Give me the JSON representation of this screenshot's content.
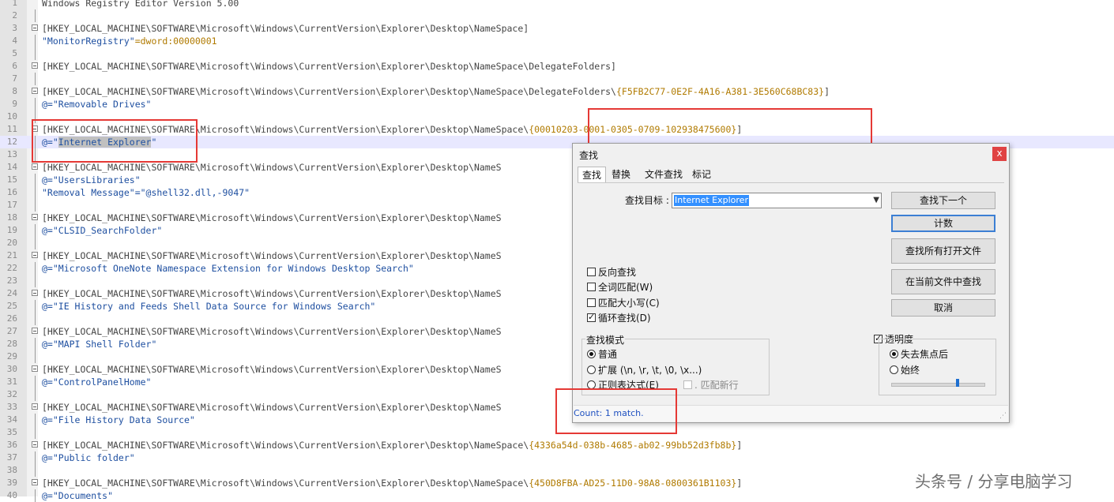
{
  "editor": {
    "lines": [
      {
        "n": "1",
        "fold": "",
        "parts": [
          {
            "t": "Windows Registry Editor Version 5.00",
            "c": "k"
          }
        ]
      },
      {
        "n": "2",
        "fold": "line",
        "parts": []
      },
      {
        "n": "3",
        "fold": "box",
        "parts": [
          {
            "t": "[HKEY_LOCAL_MACHINE\\SOFTWARE\\Microsoft\\Windows\\CurrentVersion\\Explorer\\Desktop\\NameSpace]",
            "c": "k"
          }
        ]
      },
      {
        "n": "4",
        "fold": "line",
        "parts": [
          {
            "t": "\"MonitorRegistry\"",
            "c": "str"
          },
          {
            "t": "=dword:00000001",
            "c": "g"
          }
        ]
      },
      {
        "n": "5",
        "fold": "line",
        "parts": []
      },
      {
        "n": "6",
        "fold": "box",
        "parts": [
          {
            "t": "[HKEY_LOCAL_MACHINE\\SOFTWARE\\Microsoft\\Windows\\CurrentVersion\\Explorer\\Desktop\\NameSpace\\DelegateFolders]",
            "c": "k"
          }
        ]
      },
      {
        "n": "7",
        "fold": "line",
        "parts": []
      },
      {
        "n": "8",
        "fold": "box",
        "parts": [
          {
            "t": "[HKEY_LOCAL_MACHINE\\SOFTWARE\\Microsoft\\Windows\\CurrentVersion\\Explorer\\Desktop\\NameSpace\\DelegateFolders\\",
            "c": "k"
          },
          {
            "t": "{F5FB2C77-0E2F-4A16-A381-3E560C68BC83}",
            "c": "g"
          },
          {
            "t": "]",
            "c": "k"
          }
        ]
      },
      {
        "n": "9",
        "fold": "line",
        "parts": [
          {
            "t": "@=\"Removable Drives\"",
            "c": "str"
          }
        ]
      },
      {
        "n": "10",
        "fold": "line",
        "parts": []
      },
      {
        "n": "11",
        "fold": "box",
        "parts": [
          {
            "t": "[HKEY_LOCAL_MACHINE\\SOFTWARE\\Microsoft\\Windows\\CurrentVersion\\Explorer\\Desktop\\NameSpace\\",
            "c": "k"
          },
          {
            "t": "{00010203-0001-0305-0709-102938475600}",
            "c": "g"
          },
          {
            "t": "]",
            "c": "k"
          }
        ]
      },
      {
        "n": "12",
        "fold": "line",
        "current": true,
        "parts": [
          {
            "t": "@=\"",
            "c": "str"
          },
          {
            "t": "Internet Explorer",
            "c": "str sel"
          },
          {
            "t": "\"",
            "c": "str"
          }
        ]
      },
      {
        "n": "13",
        "fold": "line",
        "parts": []
      },
      {
        "n": "14",
        "fold": "box",
        "parts": [
          {
            "t": "[HKEY_LOCAL_MACHINE\\SOFTWARE\\Microsoft\\Windows\\CurrentVersion\\Explorer\\Desktop\\NameS",
            "c": "k"
          }
        ]
      },
      {
        "n": "15",
        "fold": "line",
        "parts": [
          {
            "t": "@=\"UsersLibraries\"",
            "c": "str"
          }
        ]
      },
      {
        "n": "16",
        "fold": "line",
        "parts": [
          {
            "t": "\"Removal Message\"=\"@shell32.dll,-9047\"",
            "c": "str"
          }
        ]
      },
      {
        "n": "17",
        "fold": "line",
        "parts": []
      },
      {
        "n": "18",
        "fold": "box",
        "parts": [
          {
            "t": "[HKEY_LOCAL_MACHINE\\SOFTWARE\\Microsoft\\Windows\\CurrentVersion\\Explorer\\Desktop\\NameS",
            "c": "k"
          }
        ]
      },
      {
        "n": "19",
        "fold": "line",
        "parts": [
          {
            "t": "@=\"CLSID_SearchFolder\"",
            "c": "str"
          }
        ]
      },
      {
        "n": "20",
        "fold": "line",
        "parts": []
      },
      {
        "n": "21",
        "fold": "box",
        "parts": [
          {
            "t": "[HKEY_LOCAL_MACHINE\\SOFTWARE\\Microsoft\\Windows\\CurrentVersion\\Explorer\\Desktop\\NameS",
            "c": "k"
          }
        ]
      },
      {
        "n": "22",
        "fold": "line",
        "parts": [
          {
            "t": "@=\"Microsoft OneNote Namespace Extension for Windows Desktop Search\"",
            "c": "str"
          }
        ]
      },
      {
        "n": "23",
        "fold": "line",
        "parts": []
      },
      {
        "n": "24",
        "fold": "box",
        "parts": [
          {
            "t": "[HKEY_LOCAL_MACHINE\\SOFTWARE\\Microsoft\\Windows\\CurrentVersion\\Explorer\\Desktop\\NameS",
            "c": "k"
          }
        ]
      },
      {
        "n": "25",
        "fold": "line",
        "parts": [
          {
            "t": "@=\"IE History and Feeds Shell Data Source for Windows Search\"",
            "c": "str"
          }
        ]
      },
      {
        "n": "26",
        "fold": "line",
        "parts": []
      },
      {
        "n": "27",
        "fold": "box",
        "parts": [
          {
            "t": "[HKEY_LOCAL_MACHINE\\SOFTWARE\\Microsoft\\Windows\\CurrentVersion\\Explorer\\Desktop\\NameS",
            "c": "k"
          }
        ]
      },
      {
        "n": "28",
        "fold": "line",
        "parts": [
          {
            "t": "@=\"MAPI Shell Folder\"",
            "c": "str"
          }
        ]
      },
      {
        "n": "29",
        "fold": "line",
        "parts": []
      },
      {
        "n": "30",
        "fold": "box",
        "parts": [
          {
            "t": "[HKEY_LOCAL_MACHINE\\SOFTWARE\\Microsoft\\Windows\\CurrentVersion\\Explorer\\Desktop\\NameS",
            "c": "k"
          }
        ]
      },
      {
        "n": "31",
        "fold": "line",
        "parts": [
          {
            "t": "@=\"ControlPanelHome\"",
            "c": "str"
          }
        ]
      },
      {
        "n": "32",
        "fold": "line",
        "parts": []
      },
      {
        "n": "33",
        "fold": "box",
        "parts": [
          {
            "t": "[HKEY_LOCAL_MACHINE\\SOFTWARE\\Microsoft\\Windows\\CurrentVersion\\Explorer\\Desktop\\NameS",
            "c": "k"
          }
        ]
      },
      {
        "n": "34",
        "fold": "line",
        "parts": [
          {
            "t": "@=\"File History Data Source\"",
            "c": "str"
          }
        ]
      },
      {
        "n": "35",
        "fold": "line",
        "parts": []
      },
      {
        "n": "36",
        "fold": "box",
        "parts": [
          {
            "t": "[HKEY_LOCAL_MACHINE\\SOFTWARE\\Microsoft\\Windows\\CurrentVersion\\Explorer\\Desktop\\NameSpace\\",
            "c": "k"
          },
          {
            "t": "{4336a54d-038b-4685-ab02-99bb52d3fb8b}",
            "c": "g"
          },
          {
            "t": "]",
            "c": "k"
          }
        ]
      },
      {
        "n": "37",
        "fold": "line",
        "parts": [
          {
            "t": "@=\"Public folder\"",
            "c": "str"
          }
        ]
      },
      {
        "n": "38",
        "fold": "line",
        "parts": []
      },
      {
        "n": "39",
        "fold": "box",
        "parts": [
          {
            "t": "[HKEY_LOCAL_MACHINE\\SOFTWARE\\Microsoft\\Windows\\CurrentVersion\\Explorer\\Desktop\\NameSpace\\",
            "c": "k"
          },
          {
            "t": "{450D8FBA-AD25-11D0-98A8-0800361B1103}",
            "c": "g"
          },
          {
            "t": "]",
            "c": "k"
          }
        ]
      },
      {
        "n": "40",
        "fold": "line",
        "parts": [
          {
            "t": "@=\"Documents\"",
            "c": "str"
          }
        ]
      }
    ]
  },
  "dialog": {
    "title": "查找",
    "close": "x",
    "tabs": [
      "查找",
      "替换",
      "文件查找",
      "标记"
    ],
    "find_label": "查找目标 :",
    "find_value": "Internet Explorer",
    "buttons": {
      "find_next": "查找下一个",
      "count": "计数",
      "find_all_open": "查找所有打开文件",
      "find_in_current": "在当前文件中查找",
      "cancel": "取消"
    },
    "options": {
      "reverse": "反向查找",
      "whole_word": "全词匹配(W)",
      "match_case": "匹配大小写(C)",
      "wrap": "循环查找(D)"
    },
    "mode": {
      "legend": "查找模式",
      "normal": "普通",
      "extended": "扩展 (\\n, \\r, \\t, \\0, \\x...)",
      "regex": "正则表达式(E)",
      "dot_newline": ". 匹配新行"
    },
    "transparency": {
      "label": "透明度",
      "on_lose_focus": "失去焦点后",
      "always": "始终",
      "level": 0.72
    },
    "status": "Count: 1 match."
  },
  "watermark": "头条号 / 分享电脑学习",
  "colors": {
    "annotation": "#e53935",
    "accent": "#3390ff"
  }
}
